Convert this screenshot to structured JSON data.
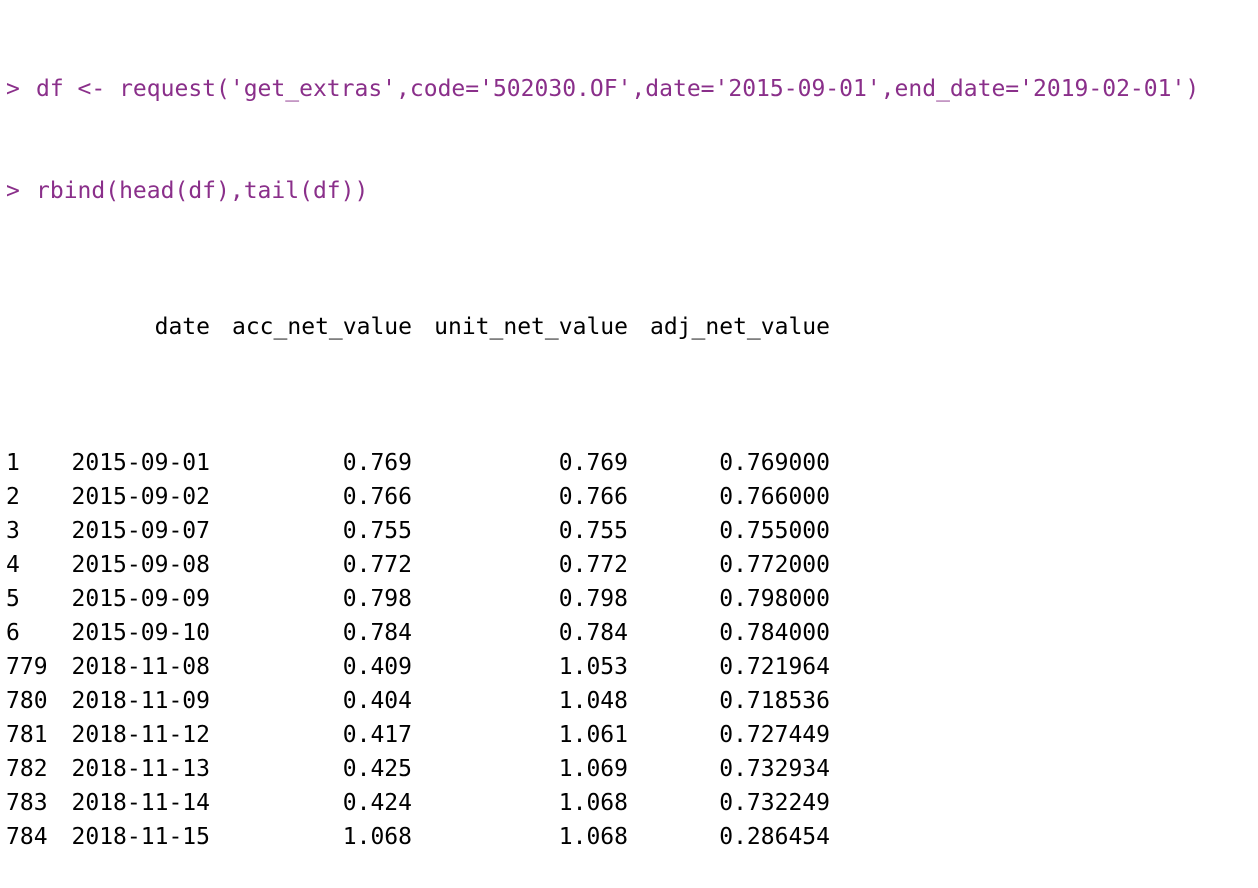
{
  "console": {
    "prompt": ">",
    "commands": [
      "df <- request('get_extras',code='502030.OF',date='2015-09-01',end_date='2019-02-01')",
      "rbind(head(df),tail(df))"
    ],
    "table": {
      "headers": [
        "",
        "date",
        "acc_net_value",
        "unit_net_value",
        "adj_net_value"
      ],
      "rows": [
        [
          "1",
          "2015-09-01",
          "0.769",
          "0.769",
          "0.769000"
        ],
        [
          "2",
          "2015-09-02",
          "0.766",
          "0.766",
          "0.766000"
        ],
        [
          "3",
          "2015-09-07",
          "0.755",
          "0.755",
          "0.755000"
        ],
        [
          "4",
          "2015-09-08",
          "0.772",
          "0.772",
          "0.772000"
        ],
        [
          "5",
          "2015-09-09",
          "0.798",
          "0.798",
          "0.798000"
        ],
        [
          "6",
          "2015-09-10",
          "0.784",
          "0.784",
          "0.784000"
        ],
        [
          "779",
          "2018-11-08",
          "0.409",
          "1.053",
          "0.721964"
        ],
        [
          "780",
          "2018-11-09",
          "0.404",
          "1.048",
          "0.718536"
        ],
        [
          "781",
          "2018-11-12",
          "0.417",
          "1.061",
          "0.727449"
        ],
        [
          "782",
          "2018-11-13",
          "0.425",
          "1.069",
          "0.732934"
        ],
        [
          "783",
          "2018-11-14",
          "0.424",
          "1.068",
          "0.732249"
        ],
        [
          "784",
          "2018-11-15",
          "1.068",
          "1.068",
          "0.286454"
        ]
      ]
    },
    "colors": {
      "command": "#8a2f8a",
      "output": "#000000",
      "background": "#ffffff"
    }
  }
}
